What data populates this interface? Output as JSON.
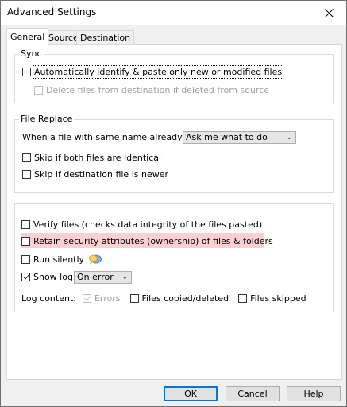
{
  "window": {
    "title": "Advanced Settings"
  },
  "tabs": [
    {
      "label": "General",
      "active": true
    },
    {
      "label": "Source",
      "active": false
    },
    {
      "label": "Destination",
      "active": false
    }
  ],
  "sync": {
    "legend": "Sync",
    "auto_identify_label": "Automatically identify & paste only new or modified files",
    "auto_identify_checked": false,
    "delete_label": "Delete files from destination if deleted from source",
    "delete_checked": false,
    "delete_enabled": false
  },
  "file_replace": {
    "legend": "File Replace",
    "exists_label": "When a file with same name already exists:",
    "exists_value": "Ask me what to do",
    "skip_identical_label": "Skip if both files are identical",
    "skip_identical_checked": false,
    "skip_newer_label": "Skip if destination file is newer",
    "skip_newer_checked": false
  },
  "misc": {
    "verify_label": "Verify files (checks data integrity of the files pasted)",
    "verify_checked": false,
    "retain_label": "Retain security attributes (ownership) of files & folders",
    "retain_checked": false,
    "retain_highlight_color": "#fbd0d0",
    "silent_label": "Run silently",
    "silent_checked": false,
    "showlog_label": "Show log",
    "showlog_checked": true,
    "showlog_value": "On error",
    "log_content_label": "Log content:",
    "errors_label": "Errors",
    "errors_checked": true,
    "errors_enabled": false,
    "copied_label": "Files copied/deleted",
    "copied_checked": false,
    "skipped_label": "Files skipped",
    "skipped_checked": false
  },
  "footer": {
    "ok": "OK",
    "cancel": "Cancel",
    "help": "Help"
  },
  "colors": {
    "accent": "#0078d7",
    "panel": "#f0f0f0",
    "speech_bubble": "#7fb2e0"
  }
}
